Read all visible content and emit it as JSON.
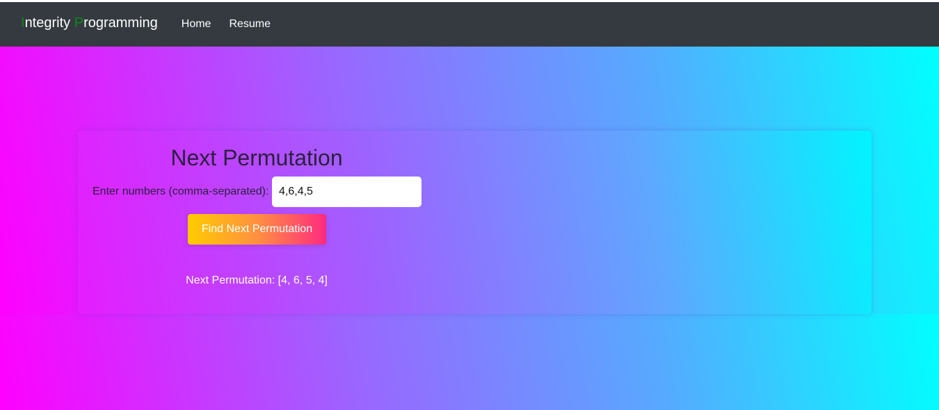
{
  "navbar": {
    "brand": {
      "first_initial": "I",
      "first_rest": "ntegrity ",
      "second_initial": "P",
      "second_rest": "rogramming"
    },
    "links": [
      "Home",
      "Resume"
    ]
  },
  "main": {
    "title": "Next Permutation",
    "input_label": "Enter numbers (comma-separated):",
    "input_value": "4,6,4,5",
    "button_label": "Find Next Permutation",
    "result_text": "Next Permutation: [4, 6, 5, 4]"
  },
  "colors": {
    "navbar": "#343a40",
    "brand_highlight": "#0a8a1a",
    "gradient_start": "#ff00ff",
    "gradient_end": "#00ffff",
    "button_start": "#ffcc00",
    "button_end": "#ff2a80"
  }
}
